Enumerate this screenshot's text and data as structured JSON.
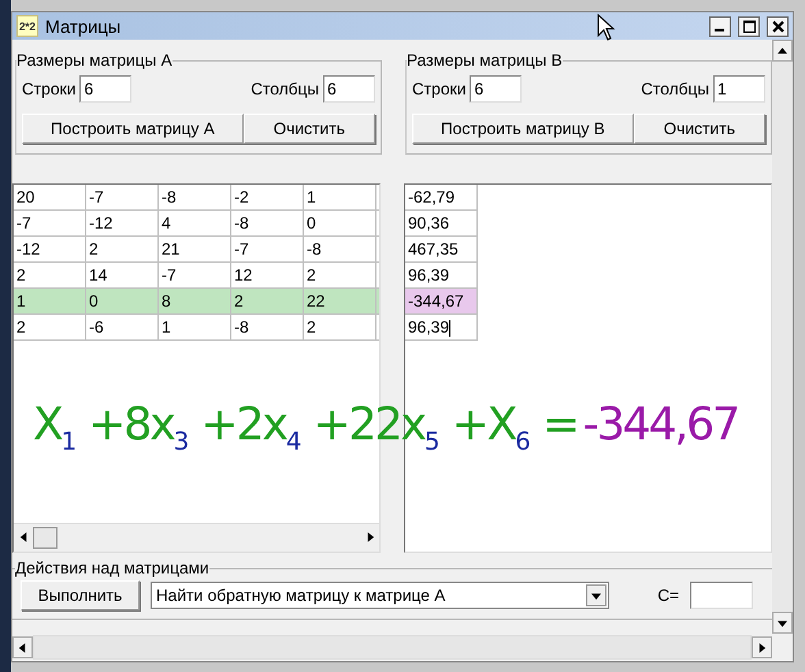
{
  "window": {
    "icon_text": "2*2",
    "title": "Матрицы"
  },
  "matrix_a_size": {
    "legend": "Размеры матрицы A",
    "rows_label": "Строки",
    "rows_value": "6",
    "cols_label": "Столбцы",
    "cols_value": "6",
    "build_button": "Построить матрицу A",
    "clear_button": "Очистить"
  },
  "matrix_b_size": {
    "legend": "Размеры матрицы B",
    "rows_label": "Строки",
    "rows_value": "6",
    "cols_label": "Столбцы",
    "cols_value": "1",
    "build_button": "Построить матрицу B",
    "clear_button": "Очистить"
  },
  "matrix_a": {
    "rows": [
      {
        "cells": [
          "20",
          "-7",
          "-8",
          "-2",
          "1"
        ],
        "highlighted": false
      },
      {
        "cells": [
          "-7",
          "-12",
          "4",
          "-8",
          "0"
        ],
        "highlighted": false
      },
      {
        "cells": [
          "-12",
          "2",
          "21",
          "-7",
          "-8"
        ],
        "highlighted": false
      },
      {
        "cells": [
          "2",
          "14",
          "-7",
          "12",
          "2"
        ],
        "highlighted": false
      },
      {
        "cells": [
          "1",
          "0",
          "8",
          "2",
          "22"
        ],
        "highlighted": true
      },
      {
        "cells": [
          "2",
          "-6",
          "1",
          "-8",
          "2"
        ],
        "highlighted": false
      }
    ]
  },
  "matrix_b": {
    "cells": [
      {
        "value": "-62,79",
        "highlighted": false,
        "editing": false
      },
      {
        "value": "90,36",
        "highlighted": false,
        "editing": false
      },
      {
        "value": "467,35",
        "highlighted": false,
        "editing": false
      },
      {
        "value": "96,39",
        "highlighted": false,
        "editing": false
      },
      {
        "value": "-344,67",
        "highlighted": true,
        "editing": false
      },
      {
        "value": "96,39",
        "highlighted": false,
        "editing": true
      }
    ]
  },
  "annotation": {
    "equation": "X$_{1}$ +8x$_{3}$ +2x$_{4}$ +22x$_{5}$ +X$_{6}$ =",
    "value": "-344,67"
  },
  "actions": {
    "legend": "Действия над матрицами",
    "run_button": "Выполнить",
    "operation": "Найти обратную матрицу к матрице A",
    "result_label": "C="
  }
}
